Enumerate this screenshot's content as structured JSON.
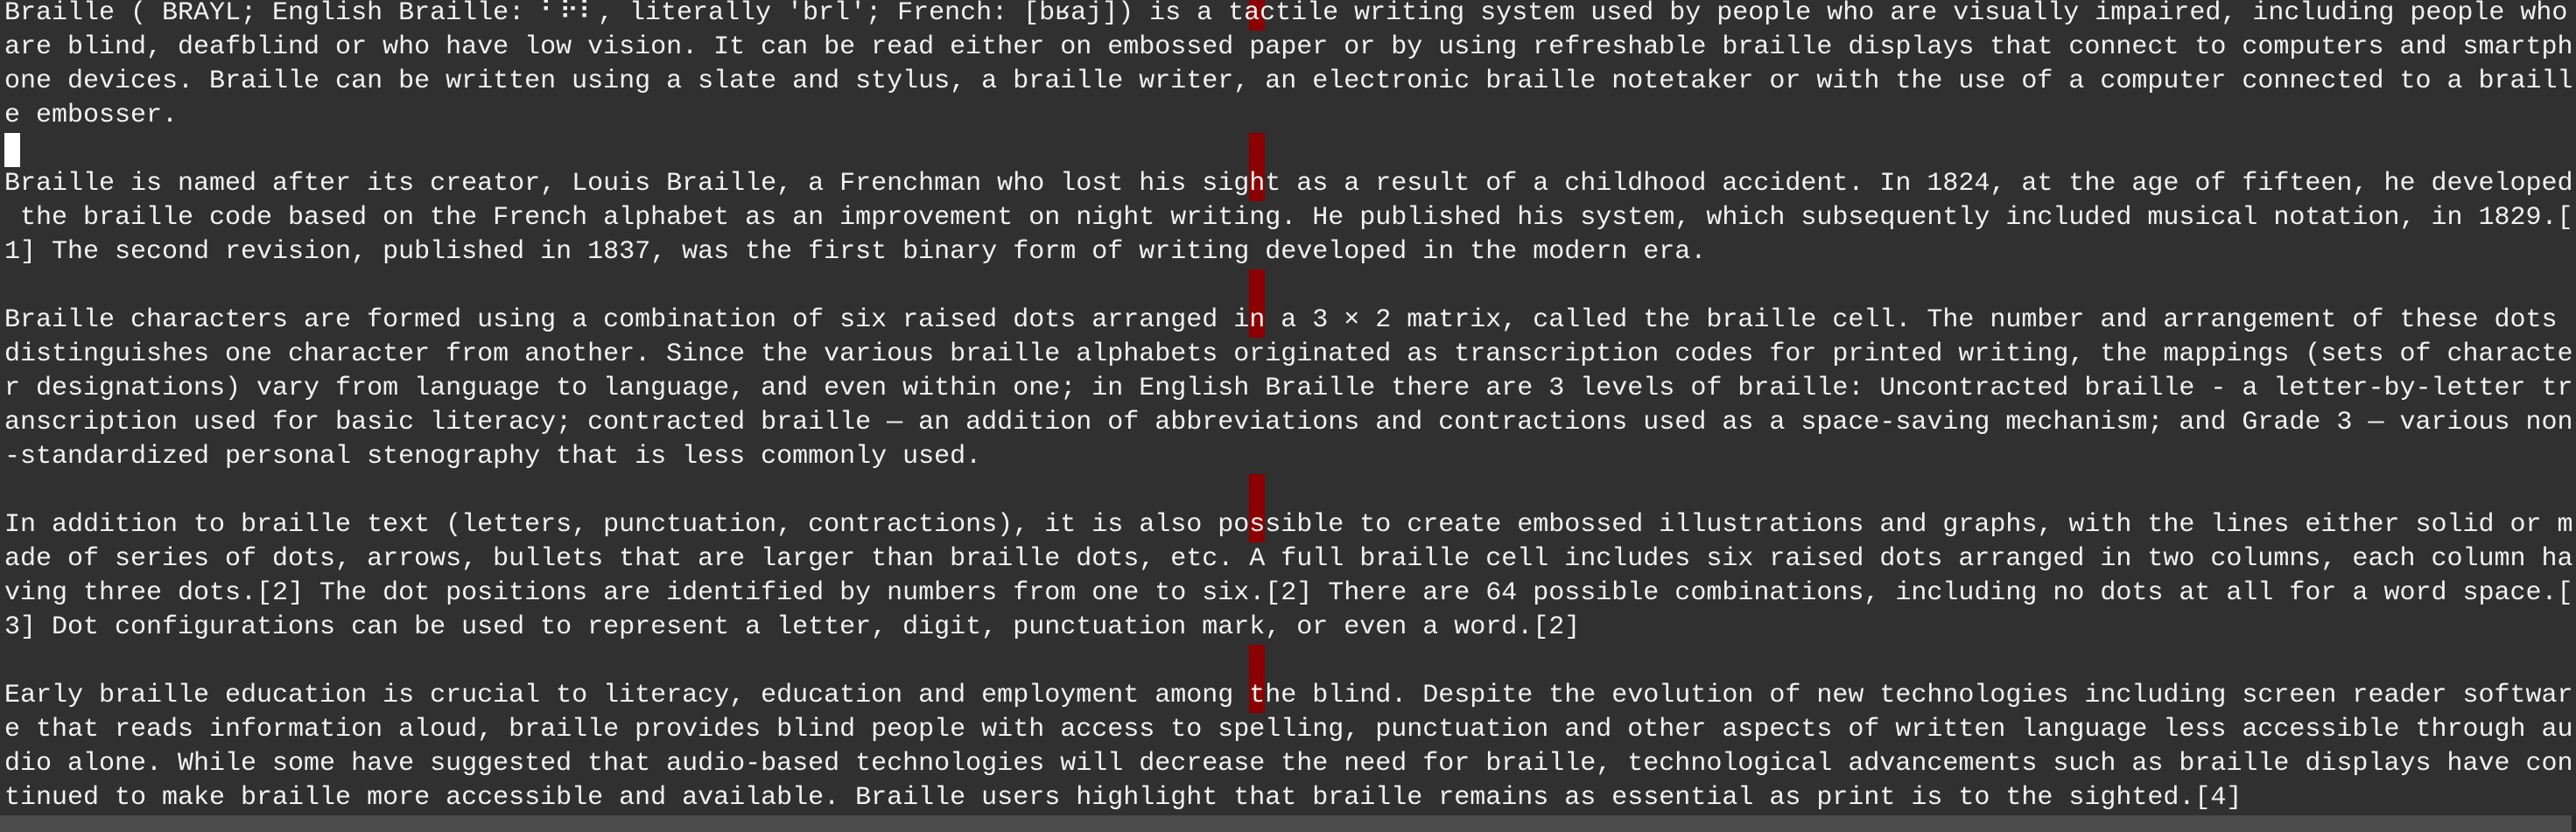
{
  "editor": {
    "highlight_column": 80,
    "colors": {
      "background": "#303030",
      "text": "#f2f2f2",
      "column_marker": "#8b0000",
      "cursor": "#ffffff",
      "statusbar": "#4b4b4b"
    },
    "cursor": {
      "line": 5,
      "column": 1
    },
    "lines": [
      "Braille ( BRAYL; English Braille: ⠃⠗⠇, literally 'brl'; French: [bʁaj]) is a tactile writing system used by people who are visually impaired, including people who",
      "are blind, deafblind or who have low vision. It can be read either on embossed paper or by using refreshable braille displays that connect to computers and smartph",
      "one devices. Braille can be written using a slate and stylus, a braille writer, an electronic braille notetaker or with the use of a computer connected to a braill",
      "e embosser.",
      "",
      "Braille is named after its creator, Louis Braille, a Frenchman who lost his sight as a result of a childhood accident. In 1824, at the age of fifteen, he developed",
      " the braille code based on the French alphabet as an improvement on night writing. He published his system, which subsequently included musical notation, in 1829.[",
      "1] The second revision, published in 1837, was the first binary form of writing developed in the modern era.",
      "",
      "Braille characters are formed using a combination of six raised dots arranged in a 3 × 2 matrix, called the braille cell. The number and arrangement of these dots ",
      "distinguishes one character from another. Since the various braille alphabets originated as transcription codes for printed writing, the mappings (sets of characte",
      "r designations) vary from language to language, and even within one; in English Braille there are 3 levels of braille: Uncontracted braille - a letter-by-letter tr",
      "anscription used for basic literacy; contracted braille — an addition of abbreviations and contractions used as a space-saving mechanism; and Grade 3 — various non",
      "-standardized personal stenography that is less commonly used.",
      "",
      "In addition to braille text (letters, punctuation, contractions), it is also possible to create embossed illustrations and graphs, with the lines either solid or m",
      "ade of series of dots, arrows, bullets that are larger than braille dots, etc. A full braille cell includes six raised dots arranged in two columns, each column ha",
      "ving three dots.[2] The dot positions are identified by numbers from one to six.[2] There are 64 possible combinations, including no dots at all for a word space.[",
      "3] Dot configurations can be used to represent a letter, digit, punctuation mark, or even a word.[2]",
      "",
      "Early braille education is crucial to literacy, education and employment among the blind. Despite the evolution of new technologies including screen reader softwar",
      "e that reads information aloud, braille provides blind people with access to spelling, punctuation and other aspects of written language less accessible through au",
      "dio alone. While some have suggested that audio-based technologies will decrease the need for braille, technological advancements such as braille displays have con",
      "tinued to make braille more accessible and available. Braille users highlight that braille remains as essential as print is to the sighted.[4]"
    ],
    "logical_line_starts": [
      0,
      4,
      5,
      8,
      9,
      14,
      15,
      19,
      20
    ]
  }
}
